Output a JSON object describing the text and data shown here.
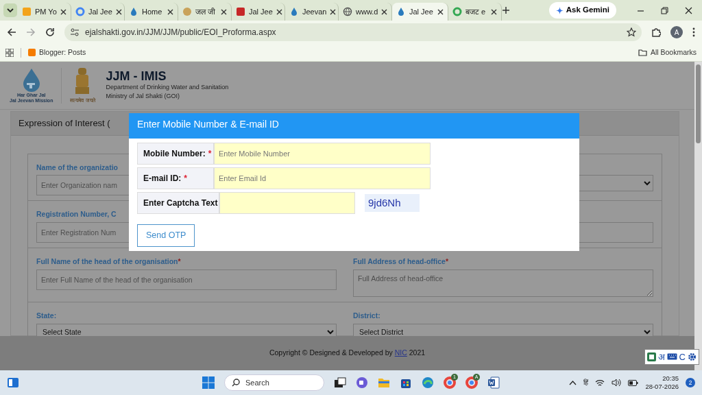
{
  "browser": {
    "tabs": [
      {
        "label": "PM Yo",
        "selected": false
      },
      {
        "label": "Jal Jee",
        "selected": false
      },
      {
        "label": "Home",
        "selected": false
      },
      {
        "label": "जल जी",
        "selected": false
      },
      {
        "label": "Jal Jee",
        "selected": false
      },
      {
        "label": "Jeevan",
        "selected": false
      },
      {
        "label": "www.d",
        "selected": false
      },
      {
        "label": "Jal Jee",
        "selected": true
      },
      {
        "label": "बजट e",
        "selected": false
      }
    ],
    "gemini": "Ask Gemini",
    "address": "ejalshakti.gov.in/JJM/JJM/public/EOI_Proforma.aspx",
    "profile": "A",
    "bookmarks": [
      {
        "label": "Blogger: Posts"
      }
    ],
    "all_bookmarks": "All Bookmarks"
  },
  "header": {
    "logo_caption": [
      "Har Ghar Jal",
      "Jal Jeevan Mission"
    ],
    "emblem_caption": "सत्यमेव जयते",
    "title": "JJM - IMIS",
    "lines": [
      "Department of Drinking Water and Sanitation",
      "Ministry of Jal Shakti (GOI)"
    ]
  },
  "card_title": "Expression of Interest (",
  "form_rows": [
    [
      {
        "kind": "input",
        "label": "Name of the organizatio",
        "placeholder": "Enter Organization nam"
      },
      {
        "kind": "select"
      }
    ],
    [
      {
        "kind": "input",
        "label": "Registration Number, C",
        "placeholder": "Enter Registration Num"
      },
      {
        "kind": "input"
      }
    ],
    [
      {
        "kind": "input",
        "label": "Full Name of the head of the organisation",
        "mark": "*",
        "placeholder": "Enter Full Name of the head of the organisation"
      },
      {
        "kind": "textarea",
        "label": "Full Address of head-office",
        "mark": "*",
        "placeholder": "Full Address of head-office"
      }
    ],
    [
      {
        "kind": "select",
        "label": "State:",
        "value": "Select State"
      },
      {
        "kind": "select",
        "label": "District:",
        "value": "Select District"
      }
    ]
  ],
  "modal": {
    "title": "Enter Mobile Number & E-mail ID",
    "fields": [
      {
        "label": "Mobile Number:",
        "mark": "*",
        "placeholder": "Enter Mobile Number"
      },
      {
        "label": "E-mail ID:",
        "mark": "*",
        "placeholder": "Enter Email Id"
      }
    ],
    "captcha_label": "Enter Captcha Text",
    "captcha": "9jd6Nh",
    "button": "Send OTP"
  },
  "footer": {
    "before": "Copyright © Designed & Developed by ",
    "link": "NIC",
    "after": " 2021"
  },
  "language_bar": [
    "अ",
    "C"
  ],
  "taskbar": {
    "search": "Search",
    "chrome_badges": [
      "1",
      "A"
    ],
    "language": "हिं",
    "time": "20:35",
    "date": "28-07-2026",
    "notifications": "2"
  }
}
